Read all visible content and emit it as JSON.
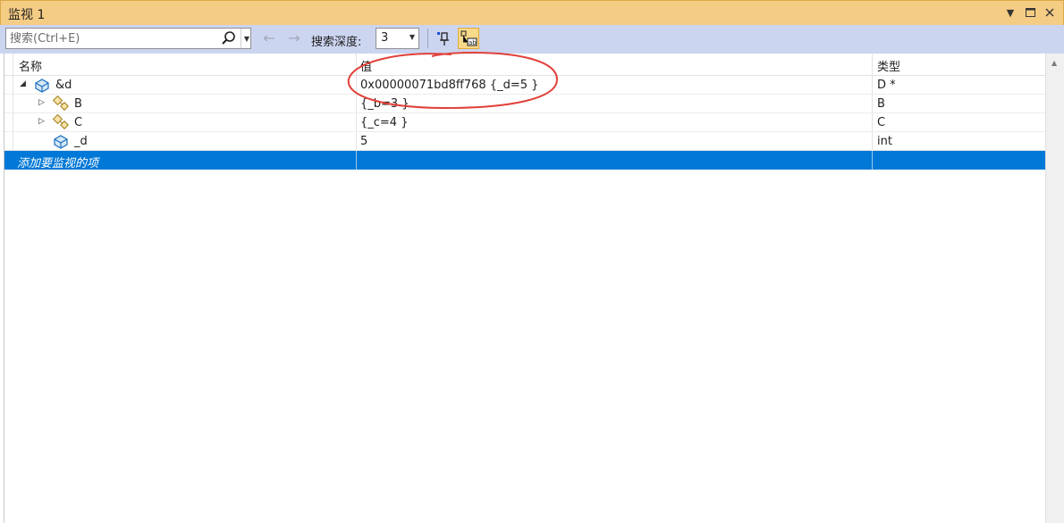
{
  "window": {
    "title": "监视 1",
    "controls": [
      "chevron-down-icon",
      "maximize-icon",
      "close-icon"
    ]
  },
  "toolbar": {
    "search_placeholder": "搜索(Ctrl+E)",
    "search_value": "",
    "depth_label": "搜索深度:",
    "depth_value": "3"
  },
  "grid": {
    "columns": [
      "名称",
      "值",
      "类型"
    ],
    "rows": [
      {
        "expander": "◢",
        "icon": "variable-icon",
        "name": "&d",
        "value": "0x00000071bd8ff768 {_d=5 }",
        "type": "D *"
      },
      {
        "expander": "▷",
        "icon": "base-class-icon",
        "name": "B",
        "value": "{_b=3 }",
        "type": "B"
      },
      {
        "expander": "▷",
        "icon": "base-class-icon",
        "name": "C",
        "value": "{_c=4 }",
        "type": "C"
      },
      {
        "expander": "",
        "icon": "field-icon",
        "name": "_d",
        "value": "5",
        "type": "int"
      }
    ],
    "add_watch_placeholder": "添加要监视的项"
  },
  "colors": {
    "title_bar": "#f5cc84",
    "toolbar": "#ccd5f0",
    "selection": "#0078d7",
    "annotation": "#e0413a"
  }
}
